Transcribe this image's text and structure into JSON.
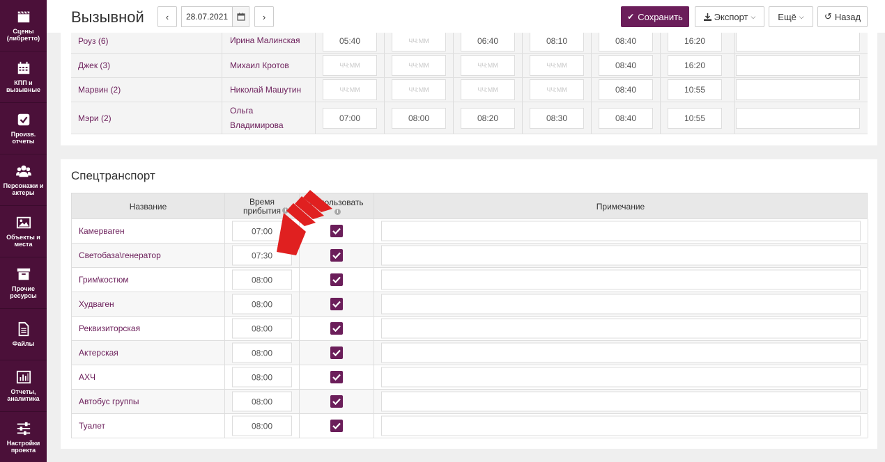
{
  "sidebar": {
    "items": [
      {
        "label": "Сцены\n(либретто)",
        "icon": "clapperboard-icon"
      },
      {
        "label": "КПП и\nвызывные",
        "icon": "calendar-icon"
      },
      {
        "label": "Произв.\nотчеты",
        "icon": "checkbox-icon"
      },
      {
        "label": "Персонажи и\nактеры",
        "icon": "users-icon"
      },
      {
        "label": "Объекты и\nместа",
        "icon": "image-icon"
      },
      {
        "label": "Прочие\nресурсы",
        "icon": "archive-icon"
      },
      {
        "label": "Файлы",
        "icon": "file-icon"
      },
      {
        "label": "Отчеты,\nаналитика",
        "icon": "bar-chart-icon"
      },
      {
        "label": "Настройки\nпроекта",
        "icon": "sliders-icon"
      }
    ]
  },
  "header": {
    "title": "Вызывной",
    "prev": "‹",
    "next": "›",
    "date": "28.07.2021",
    "save_label": "Сохранить",
    "export_label": "Экспорт",
    "more_label": "Ещё",
    "back_label": "Назад"
  },
  "cast_rows": [
    {
      "role": "Роуз (6)",
      "actor": "Ирина Малинская",
      "times": [
        "05:40",
        "ЧЧ:ММ",
        "06:40",
        "08:10",
        "08:40",
        "16:20"
      ]
    },
    {
      "role": "Джек (3)",
      "actor": "Михаил Кротов",
      "times": [
        "ЧЧ:ММ",
        "ЧЧ:ММ",
        "ЧЧ:ММ",
        "ЧЧ:ММ",
        "08:40",
        "16:20"
      ]
    },
    {
      "role": "Марвин (2)",
      "actor": "Николай Машутин",
      "times": [
        "ЧЧ:ММ",
        "ЧЧ:ММ",
        "ЧЧ:ММ",
        "ЧЧ:ММ",
        "08:40",
        "10:55"
      ]
    },
    {
      "role": "Мэри (2)",
      "actor": "Ольга Владимирова",
      "times": [
        "07:00",
        "08:00",
        "08:20",
        "08:30",
        "08:40",
        "10:55"
      ]
    }
  ],
  "transport": {
    "title": "Спецтранспорт",
    "col_name": "Название",
    "col_time": "Время прибытия",
    "col_use": "Использовать",
    "col_note": "Примечание",
    "rows": [
      {
        "name": "Камерваген",
        "time": "07:00",
        "used": true
      },
      {
        "name": "Светобаза\\генератор",
        "time": "07:30",
        "used": true
      },
      {
        "name": "Грим\\костюм",
        "time": "08:00",
        "used": true
      },
      {
        "name": "Худваген",
        "time": "08:00",
        "used": true
      },
      {
        "name": "Реквизиторская",
        "time": "08:00",
        "used": true
      },
      {
        "name": "Актерская",
        "time": "08:00",
        "used": true
      },
      {
        "name": "АХЧ",
        "time": "08:00",
        "used": true
      },
      {
        "name": "Автобус группы",
        "time": "08:00",
        "used": true
      },
      {
        "name": "Туалет",
        "time": "08:00",
        "used": true
      }
    ]
  },
  "colors": {
    "sidebar": "#4b1039",
    "accent": "#6b1e5a",
    "arrow": "#e02020"
  }
}
